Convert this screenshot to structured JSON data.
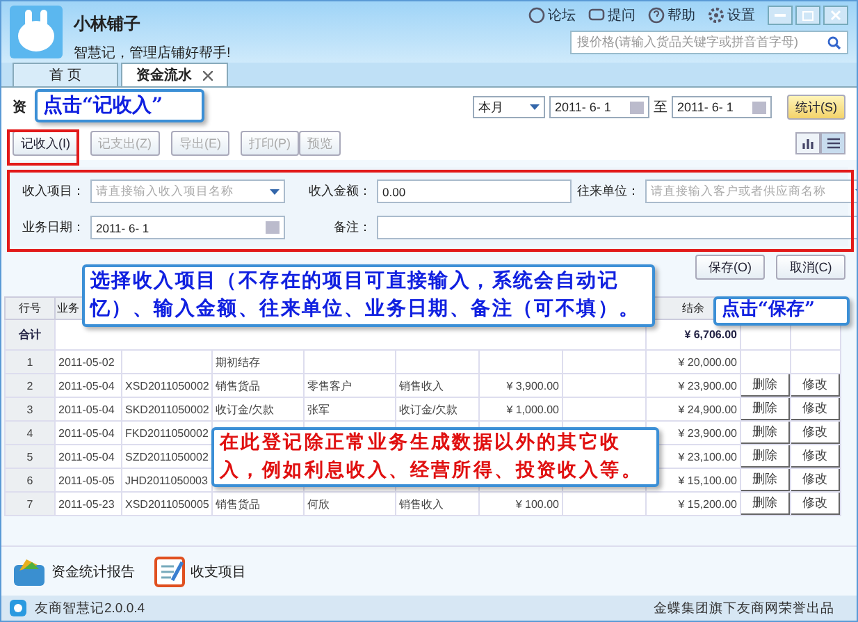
{
  "app": {
    "name": "小林铺子",
    "slogan": "智慧记，管理店铺好帮手!",
    "links": [
      {
        "kind": "forum",
        "label": "论坛"
      },
      {
        "kind": "ask",
        "label": "提问"
      },
      {
        "kind": "help",
        "label": "帮助"
      },
      {
        "kind": "settings",
        "label": "设置"
      }
    ],
    "search": {
      "placeholder": "搜价格(请输入货品关键字或拼音首字母)"
    }
  },
  "tabs": [
    {
      "label": "首 页",
      "selected": false,
      "closable": false
    },
    {
      "label": "资金流水",
      "selected": true,
      "closable": true
    }
  ],
  "page_title": "资",
  "period": {
    "value": "本月",
    "from": "2011- 6- 1",
    "separator": "至",
    "to": "2011- 6- 1",
    "button": "统计(S)"
  },
  "toolbar": [
    [
      {
        "label": "记收入(I)",
        "disabled": false
      }
    ],
    [
      {
        "label": "记支出(Z)",
        "disabled": true
      }
    ],
    [
      {
        "label": "导出(E)",
        "disabled": true
      }
    ],
    [
      {
        "label": "打印(P)",
        "disabled": true
      },
      {
        "label": "预览",
        "disabled": true
      }
    ]
  ],
  "view_toggle": [
    {
      "kind": "chart",
      "selected": false
    },
    {
      "kind": "list",
      "selected": true
    }
  ],
  "form": {
    "item": {
      "label": "收入项目：",
      "placeholder": "请直接输入收入项目名称"
    },
    "amount": {
      "label": "收入金额：",
      "value": "0.00"
    },
    "partner": {
      "label": "往来单位：",
      "placeholder": "请直接输入客户或者供应商名称"
    },
    "date": {
      "label": "业务日期：",
      "value": "2011- 6- 1"
    },
    "note": {
      "label": "备注："
    }
  },
  "form_buttons": [
    "保存(O)",
    "取消(C)"
  ],
  "table": {
    "columns": [
      "行号",
      "业务",
      "结余"
    ],
    "total": {
      "label": "合计",
      "balance": "¥ 6,706.00"
    },
    "rows": [
      {
        "no": "1",
        "date": "2011-05-02",
        "item": "期初结存",
        "balance": "¥ 20,000.00"
      },
      {
        "no": "2",
        "date": "2011-05-04",
        "number": "XSD2011050002",
        "item": "销售货品",
        "partner": "零售客户",
        "category": "销售收入",
        "income": "¥ 3,900.00",
        "balance": "¥ 23,900.00",
        "actions": [
          "删除",
          "修改"
        ]
      },
      {
        "no": "3",
        "date": "2011-05-04",
        "number": "SKD2011050002",
        "item": "收订金/欠款",
        "partner": "张军",
        "category": "收订金/欠款",
        "income": "¥ 1,000.00",
        "balance": "¥ 24,900.00",
        "actions": [
          "删除",
          "修改"
        ]
      },
      {
        "no": "4",
        "date": "2011-05-04",
        "number": "FKD2011050002",
        "balance": "¥ 23,900.00",
        "actions": [
          "删除",
          "修改"
        ]
      },
      {
        "no": "5",
        "date": "2011-05-04",
        "number": "SZD2011050002",
        "balance": "¥ 23,100.00",
        "actions": [
          "删除",
          "修改"
        ]
      },
      {
        "no": "6",
        "date": "2011-05-05",
        "number": "JHD2011050003",
        "balance": "¥ 15,100.00",
        "actions": [
          "删除",
          "修改"
        ]
      },
      {
        "no": "7",
        "date": "2011-05-23",
        "number": "XSD2011050005",
        "item": "销售货品",
        "partner": "何欣",
        "category": "销售收入",
        "income": "¥ 100.00",
        "balance": "¥ 15,200.00",
        "actions": [
          "删除",
          "修改"
        ]
      }
    ]
  },
  "shortcuts": [
    {
      "kind": "report",
      "label": "资金统计报告"
    },
    {
      "kind": "items",
      "label": "收支项目"
    }
  ],
  "status_bar": {
    "version": "友商智慧记2.0.0.4",
    "credit": "金蝶集团旗下友商网荣誉出品"
  },
  "callouts": [
    {
      "kind": "blue",
      "text": "点击“记收入”"
    },
    {
      "kind": "blue",
      "text": "选择收入项目（不存在的项目可直接输入，系统会自动记忆）、输入金额、往来单位、业务日期、备注（可不填）。"
    },
    {
      "kind": "blue",
      "text": "点击“保存”"
    },
    {
      "kind": "red",
      "text": "在此登记除正常业务生成数据以外的其它收入，例如利息收入、经营所得、投资收入等。"
    }
  ]
}
